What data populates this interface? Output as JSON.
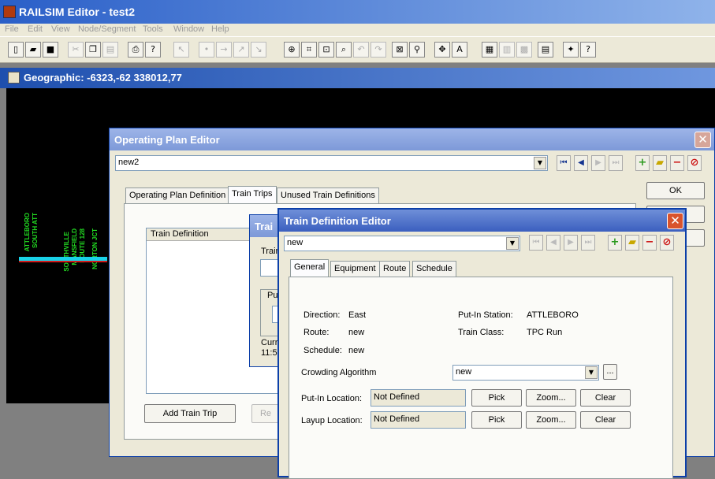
{
  "app": {
    "title": "RAILSIM Editor - test2",
    "menu": [
      "File",
      "Edit",
      "View",
      "Node/Segment",
      "Tools",
      "Window",
      "Help"
    ],
    "toolbar_icons": [
      "new-icon",
      "open-icon",
      "save-icon",
      "cut-icon",
      "copy-icon",
      "paste-icon",
      "print-icon",
      "help-icon",
      "pointer-icon",
      "node-icon",
      "segment-add-icon",
      "segment-edit-icon",
      "segment-delete-icon",
      "zoom-in-icon",
      "zoom-fit-icon",
      "zoom-window-icon",
      "zoom-select-icon",
      "undo-icon",
      "redo-icon",
      "zoom-prev-icon",
      "find-icon",
      "pan-icon",
      "text-icon",
      "properties-icon",
      "layers-icon",
      "grid-icon",
      "report-icon",
      "map-icon",
      "about-icon"
    ]
  },
  "geographic": {
    "title": "Geographic: -6323,-62 338012,77",
    "stations": [
      "ATTLEBORO",
      "SOUTH ATT",
      "SOUTHVILLE",
      "MANSFIELD",
      "ROUTE 128",
      "NORTON JCT"
    ]
  },
  "operating_plan_editor": {
    "title": "Operating Plan Editor",
    "selected_plan": "new2",
    "ok_label": "OK",
    "tabs": [
      "Operating Plan Definition",
      "Train Trips",
      "Unused Train Definitions"
    ],
    "active_tab": "Train Trips",
    "list_header": "Train Definition",
    "add_trip_label": "Add Train Trip",
    "remove_label": "Re"
  },
  "train_trips_window": {
    "title": "Trai",
    "row1_label": "Train",
    "group_label": "Pu",
    "current_label": "Curr",
    "current_value": "11:5"
  },
  "train_definition_editor": {
    "title": "Train Definition Editor",
    "selected_train": "new",
    "tabs": [
      "General",
      "Equipment",
      "Route",
      "Schedule"
    ],
    "active_tab": "General",
    "direction_label": "Direction:",
    "direction_value": "East",
    "route_label": "Route:",
    "route_value": "new",
    "schedule_label": "Schedule:",
    "schedule_value": "new",
    "putin_station_label": "Put-In Station:",
    "putin_station_value": "ATTLEBORO",
    "train_class_label": "Train Class:",
    "train_class_value": "TPC Run",
    "crowding_label": "Crowding Algorithm",
    "crowding_value": "new",
    "ellipsis_label": "...",
    "putin_location_label": "Put-In Location:",
    "putin_location_value": "Not Defined",
    "layup_location_label": "Layup Location:",
    "layup_location_value": "Not Defined",
    "pick_label": "Pick",
    "zoom_label": "Zoom...",
    "clear_label": "Clear"
  }
}
